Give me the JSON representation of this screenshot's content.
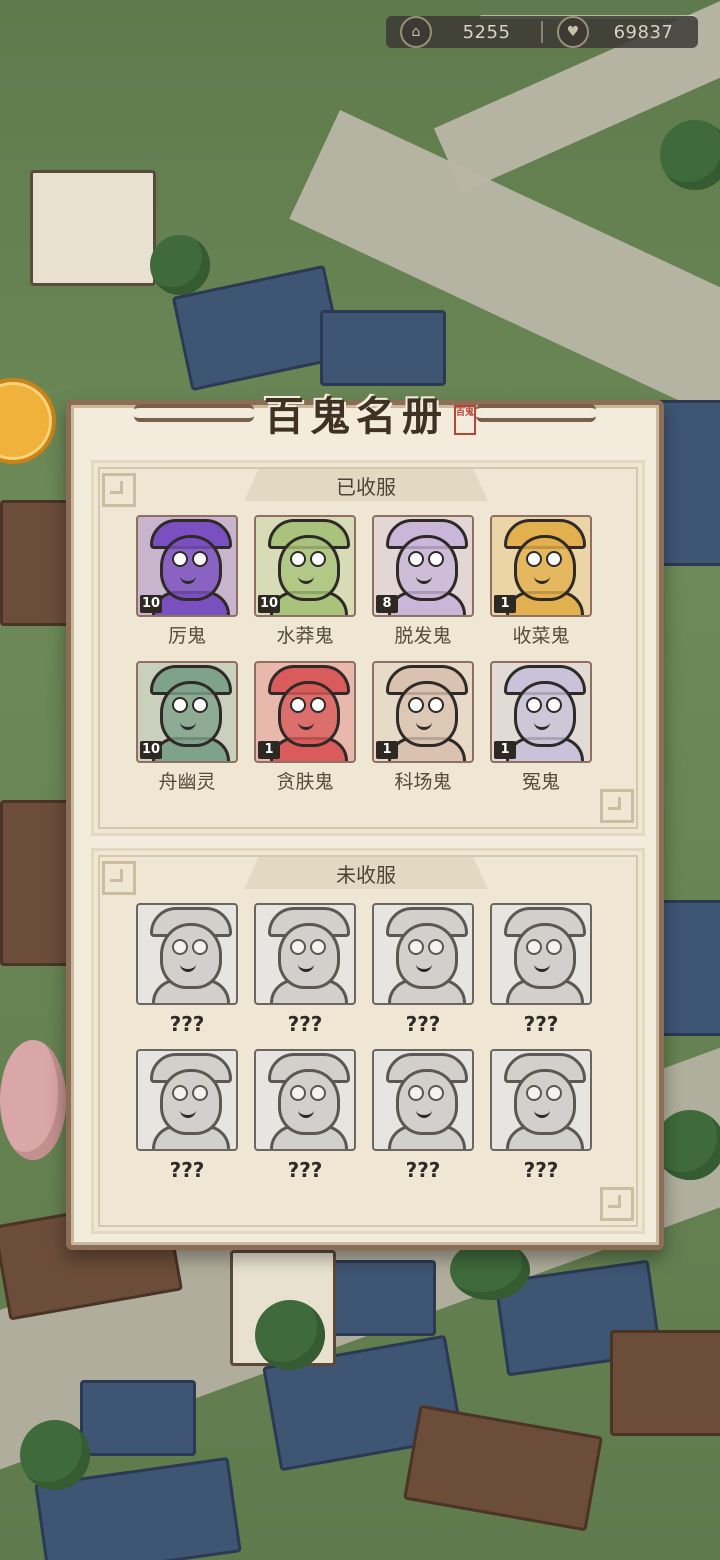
{
  "resources": {
    "currency1": {
      "icon": "pavilion-icon",
      "value": "5255"
    },
    "currency2": {
      "icon": "heart-icon",
      "value": "69837"
    }
  },
  "modal": {
    "title": "百鬼名册",
    "seal": "百鬼",
    "collected": {
      "header": "已收服",
      "items": [
        {
          "name": "厉鬼",
          "level": "10",
          "color": "#7a4fbf"
        },
        {
          "name": "水莽鬼",
          "level": "10",
          "color": "#a9c37c"
        },
        {
          "name": "脱发鬼",
          "level": "8",
          "color": "#c9b6d9"
        },
        {
          "name": "收菜鬼",
          "level": "1",
          "color": "#e3b04f"
        },
        {
          "name": "舟幽灵",
          "level": "10",
          "color": "#7fa38a"
        },
        {
          "name": "贪肤鬼",
          "level": "1",
          "color": "#d95b5b"
        },
        {
          "name": "科场鬼",
          "level": "1",
          "color": "#d9c3b0"
        },
        {
          "name": "冤鬼",
          "level": "1",
          "color": "#c8c3d8"
        }
      ]
    },
    "uncollected": {
      "header": "未收服",
      "items": [
        {
          "name": "???"
        },
        {
          "name": "???"
        },
        {
          "name": "???"
        },
        {
          "name": "???"
        },
        {
          "name": "???"
        },
        {
          "name": "???"
        },
        {
          "name": "???"
        },
        {
          "name": "???"
        }
      ]
    }
  }
}
